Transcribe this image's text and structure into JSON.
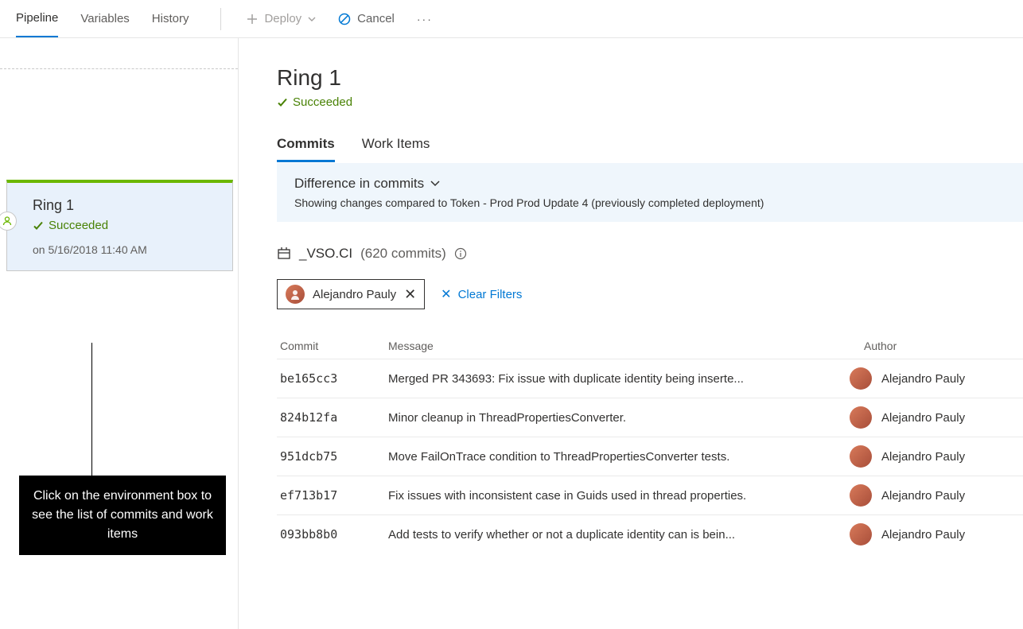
{
  "toolbar": {
    "tabs": [
      "Pipeline",
      "Variables",
      "History"
    ],
    "deploy": "Deploy",
    "cancel": "Cancel"
  },
  "env_card": {
    "title": "Ring 1",
    "status": "Succeeded",
    "timestamp": "on 5/16/2018 11:40 AM"
  },
  "callout": "Click on the environment box to see the list of commits and work items",
  "detail": {
    "title": "Ring 1",
    "status": "Succeeded",
    "tabs": [
      "Commits",
      "Work Items"
    ],
    "diff_title": "Difference in commits",
    "diff_sub": "Showing changes compared to Token - Prod Prod Update 4 (previously completed deployment)",
    "repo_name": "_VSO.CI",
    "repo_count": "(620 commits)",
    "filter_author": "Alejandro Pauly",
    "clear_filters": "Clear Filters",
    "headers": {
      "commit": "Commit",
      "message": "Message",
      "author": "Author"
    },
    "commits": [
      {
        "hash": "be165cc3",
        "msg": "Merged PR 343693: Fix issue with duplicate identity being inserte...",
        "author": "Alejandro Pauly"
      },
      {
        "hash": "824b12fa",
        "msg": "Minor cleanup in ThreadPropertiesConverter.",
        "author": "Alejandro Pauly"
      },
      {
        "hash": "951dcb75",
        "msg": "Move FailOnTrace condition to ThreadPropertiesConverter tests.",
        "author": "Alejandro Pauly"
      },
      {
        "hash": "ef713b17",
        "msg": "Fix issues with inconsistent case in Guids used in thread properties.",
        "author": "Alejandro Pauly"
      },
      {
        "hash": "093bb8b0",
        "msg": "Add tests to verify whether or not a duplicate identity can is bein...",
        "author": "Alejandro Pauly"
      }
    ]
  }
}
